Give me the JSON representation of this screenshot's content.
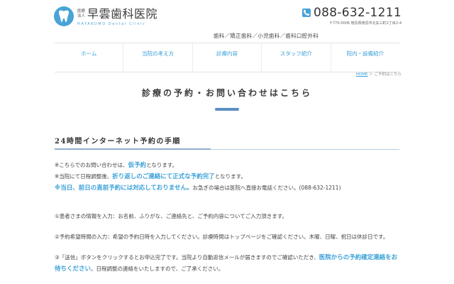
{
  "header": {
    "logo_corp_line1": "医療",
    "logo_corp_line2": "法人",
    "logo_name": "早雲歯科医院",
    "logo_sub": "HAYAKUMO Dental Clinic",
    "phone": "088-632-1211",
    "address": "〒770-0006 徳島県徳島市北矢三町2丁目2-4",
    "specialties": "歯科／矯正歯科／小児歯科／歯科口腔外科"
  },
  "nav": {
    "items": [
      {
        "label": "ホーム"
      },
      {
        "label": "当院の考え方"
      },
      {
        "label": "診療内容"
      },
      {
        "label": "スタッフ紹介"
      },
      {
        "label": "院内・設備紹介"
      }
    ]
  },
  "breadcrumb": {
    "home": "HOME",
    "sep": " ＞ ",
    "current": "ご予約はこちら"
  },
  "page": {
    "title": "診療の予約・お問い合わせはこちら",
    "section_title": "24時間インターネット予約の手順"
  },
  "content": {
    "note1_pre": "※こちらでのお問い合わせは、",
    "note1_hl": "仮予約",
    "note1_post": "となります。",
    "note2_pre": "※当院にて日程調整後、",
    "note2_hl": "折り返しのご連絡にて正式な予約完了",
    "note2_post": "となります。",
    "note3_hl": "※当日、前日の直前予約には対応しておりません。",
    "note3_post": "お急ぎの場合は医院へ直接お電話ください。(088-632-1211)",
    "step1": "①患者さまの情報を入力：お名前、ふりがな、ご連絡先と、ご予約内容についてご入力頂きます。",
    "step2": "②予約希望時間の入力：希望の予約日時を入力してください。診療時間はトップページをご確認ください。木曜、日曜、祝日は休診日です。",
    "step3_pre": "③「送信」ボタンをクリックするとお申込完了です。当院より自動返信メールが届きますのでご確認いただき、",
    "step3_hl": "医院からの予約確定連絡をお待ちください",
    "step3_post": "。日程調整の連絡をいたしますので、ご了承ください。"
  },
  "colors": {
    "accent": "#3aa0d8",
    "title_bar": "#5a8fc4"
  }
}
